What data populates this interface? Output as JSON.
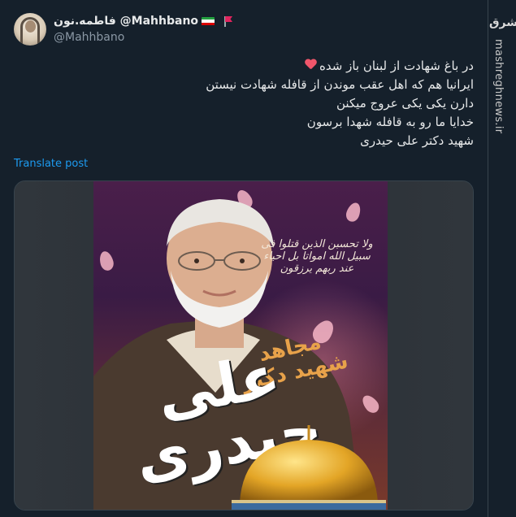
{
  "author": {
    "display_name": "فاطمه.نون @Mahhbano",
    "handle": "@Mahhbano"
  },
  "tweet": {
    "lines": [
      "در باغ شهادت از لبنان باز شده",
      "ایرانیا هم که اهل عقب موندن از قافله شهادت نیستن",
      "دارن یکی یکی عروج میکنن",
      "خدایا ما رو به قافله شهدا برسون",
      "شهید دکتر علی حیدری"
    ],
    "translate_label": "Translate post"
  },
  "poster": {
    "subtitle": "مجاهد شهید دکتر",
    "name": "علی حیدری",
    "verse": "ولا تحسبن الذین قتلوا فی سبیل الله امواتا بل احیاء عند ربهم یرزقون"
  },
  "watermark": {
    "logo_text": "مشرق",
    "site": "mashreghnews.ir"
  },
  "colors": {
    "background": "#15202b",
    "link": "#1d9bf0",
    "text": "#e7e9ea",
    "muted": "#8b98a5"
  }
}
